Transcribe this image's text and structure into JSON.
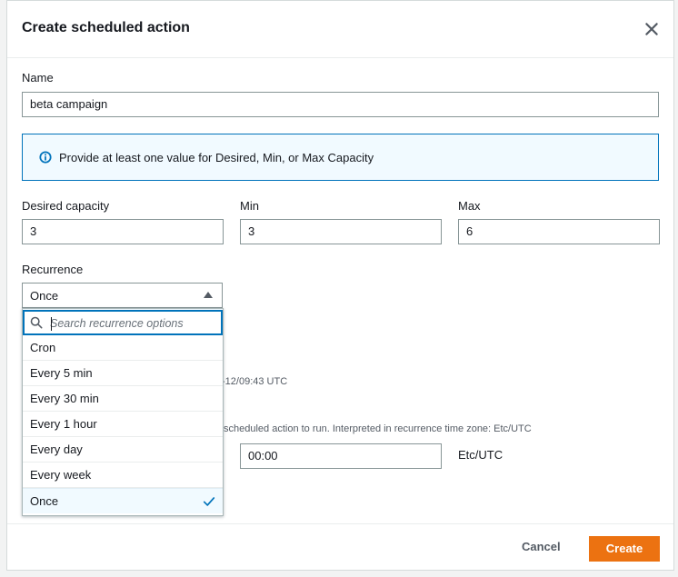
{
  "dialog": {
    "title": "Create scheduled action"
  },
  "name": {
    "label": "Name",
    "value": "beta campaign"
  },
  "info": {
    "text": "Provide at least one value for Desired, Min, or Max Capacity"
  },
  "capacity": {
    "desired": {
      "label": "Desired capacity",
      "value": "3"
    },
    "min": {
      "label": "Min",
      "value": "3"
    },
    "max": {
      "label": "Max",
      "value": "6"
    }
  },
  "recurrence": {
    "label": "Recurrence",
    "selected": "Once",
    "search_placeholder": "Search recurrence options",
    "options": [
      "Cron",
      "Every 5 min",
      "Every 30 min",
      "Every 1 hour",
      "Every day",
      "Every week",
      "Once"
    ]
  },
  "partial": {
    "timestamp_hint": "-12/09:43 UTC",
    "time_hint": "scheduled action to run. Interpreted in recurrence time zone: Etc/UTC",
    "time_value": "00:00",
    "timezone": "Etc/UTC"
  },
  "footer": {
    "cancel": "Cancel",
    "create": "Create"
  },
  "colors": {
    "primary": "#ec7211",
    "link": "#0073bb",
    "info_bg": "#f1faff"
  },
  "icons": {
    "close": "close-icon",
    "info": "info-icon",
    "search": "search-icon",
    "check": "check-icon",
    "caret": "caret-up-icon"
  }
}
